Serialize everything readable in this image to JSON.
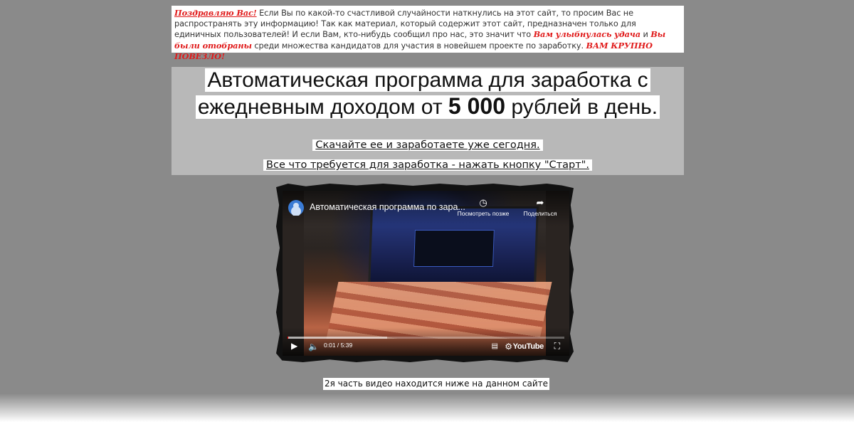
{
  "notice": {
    "congrats": "Поздравляю Вас!",
    "p1": " Если Вы по какой-то счастливой случайности наткнулись на этот сайт, то просим Вас не распространять эту информацию! Так как материал, который содержит этот сайт, предназначен только для единичных пользователей! И если Вам, кто-нибудь сообщил про нас, это значит что ",
    "luck": "Вам улыбнулась удача",
    "and": " и ",
    "chosen": "Вы были отобраны",
    "p2": " среди множества кандидатов для участия в новейшем проекте по заработку. ",
    "lucky": "ВАМ КРУПНО ПОВЕЗЛО!"
  },
  "hero": {
    "line1": "Автоматическая программа для заработка с",
    "line2_prefix": "ежедневным доходом от ",
    "line2_amount": "5 000",
    "line2_suffix": " рублей в день.",
    "cta1": "Скачайте ее и заработаете уже сегодня. ",
    "cta2": "Все что требуется для заработка - нажать кнопку \"Старт\"."
  },
  "video": {
    "title": "Автоматическая программа по зара...",
    "watch_later": "Посмотреть позже",
    "share": "Поделиться",
    "time": "0:01 / 5:39",
    "youtube": "YouTube",
    "progress": 0.003,
    "buffered": 0.36,
    "colors": {
      "progress": "#ff0000"
    },
    "icons": [
      "play-icon",
      "volume-icon",
      "subtitles-icon",
      "settings-icon",
      "fullscreen-icon",
      "clock-icon",
      "share-icon"
    ]
  },
  "caption": "2я часть видео находится ниже на данном сайте"
}
